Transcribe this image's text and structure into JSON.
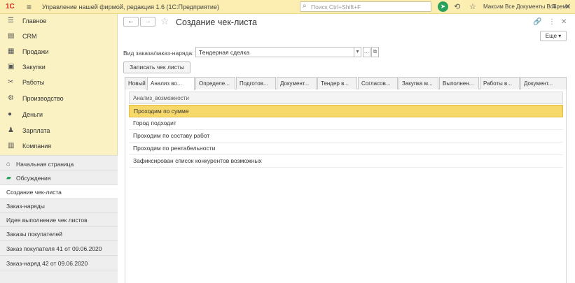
{
  "titlebar": {
    "logo": "1С",
    "menu_icon": "hamburger-icon",
    "title": "Управление нашей фирмой, редакция 1.6  (1С:Предприятие)",
    "search_placeholder": "Поиск Ctrl+Shift+F",
    "user": "Максим Все Документы Вовремя"
  },
  "sidebar": {
    "sections": [
      {
        "label": "Главное",
        "icon": "menu-icon"
      },
      {
        "label": "CRM",
        "icon": "crm-icon"
      },
      {
        "label": "Продажи",
        "icon": "sales-icon"
      },
      {
        "label": "Закупки",
        "icon": "purchases-icon"
      },
      {
        "label": "Работы",
        "icon": "works-icon"
      },
      {
        "label": "Производство",
        "icon": "production-icon"
      },
      {
        "label": "Деньги",
        "icon": "money-icon"
      },
      {
        "label": "Зарплата",
        "icon": "salary-icon"
      },
      {
        "label": "Компания",
        "icon": "company-icon"
      }
    ],
    "open_windows": [
      {
        "label": "Начальная страница",
        "icon": "home-icon"
      },
      {
        "label": "Обсуждения",
        "icon": "chat-icon"
      },
      {
        "label": "Создание чек-листа"
      },
      {
        "label": "Заказ-наряды"
      },
      {
        "label": "Идея выполнение чек листов"
      },
      {
        "label": "Заказы покупателей"
      },
      {
        "label": "Заказ покупателя 41 от 09.06.2020"
      },
      {
        "label": "Заказ-наряд 42 от 09.06.2020"
      }
    ]
  },
  "main": {
    "title": "Создание чек-листа",
    "more_label": "Еще",
    "field_label": "Вид заказа/заказ-наряда:",
    "field_value": "Тендерная сделка",
    "save_label": "Записать чек листы",
    "tabs": [
      "Новый",
      "Анализ во...",
      "Определе...",
      "Подготов...",
      "Документ...",
      "Тендер в...",
      "Согласов...",
      "Закупка м...",
      "Выполнен...",
      "Работы в...",
      "Документ..."
    ],
    "active_tab_index": 1,
    "column_header": "Анализ_возможности",
    "rows": [
      "Проходим по сумме",
      "Город подходит",
      "Проходим по составу работ",
      "Проходим по рентабельности",
      "Зафиксирован список конкурентов возможных"
    ],
    "selected_row_index": 0
  }
}
